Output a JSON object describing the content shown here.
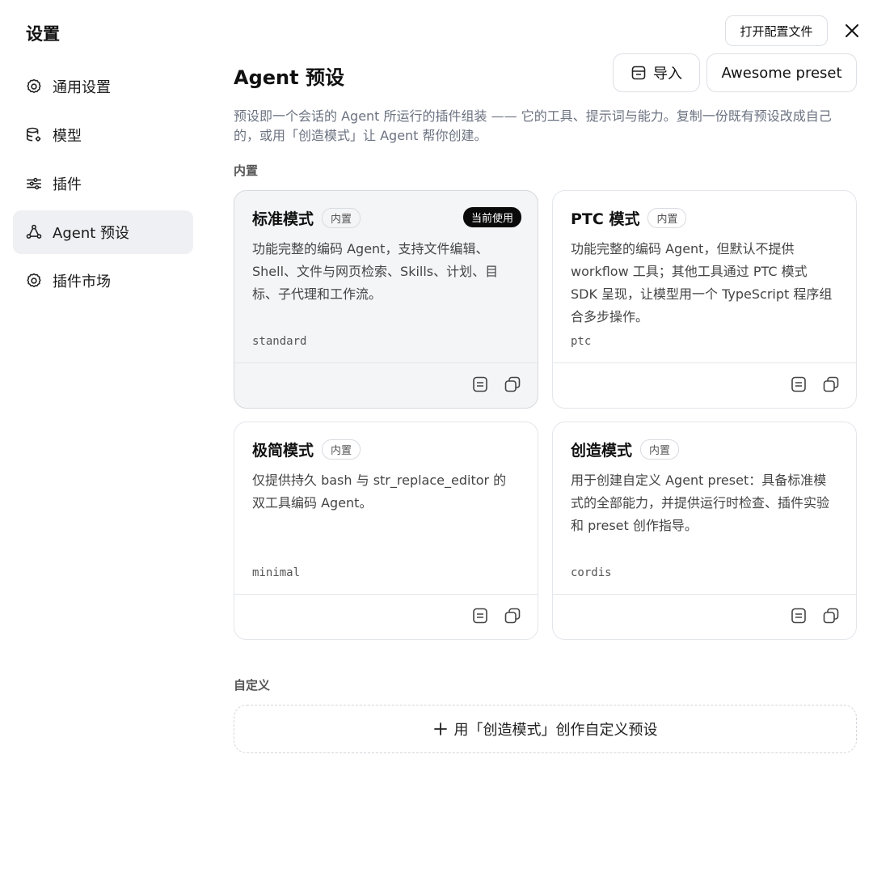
{
  "sidebar": {
    "title": "设置",
    "items": [
      {
        "label": "通用设置",
        "icon": "gear-icon"
      },
      {
        "label": "模型",
        "icon": "database-gear-icon"
      },
      {
        "label": "插件",
        "icon": "sliders-icon"
      },
      {
        "label": "Agent 预设",
        "icon": "agent-nodes-icon",
        "active": true
      },
      {
        "label": "插件市场",
        "icon": "gear-icon"
      }
    ]
  },
  "header": {
    "open_config": "打开配置文件",
    "close_icon": "close-icon"
  },
  "main": {
    "title": "Agent 预设",
    "import_label": "导入",
    "awesome_label": "Awesome preset",
    "description": "预设即一个会话的 Agent 所运行的插件组装 —— 它的工具、提示词与能力。复制一份既有预设改成自己的，或用「创造模式」让 Agent 帮你创建。",
    "builtin_label": "内置",
    "custom_label": "自定义",
    "create_label": "用「创造模式」创作自定义预设"
  },
  "presets": [
    {
      "title": "标准模式",
      "badge": "内置",
      "current": "当前使用",
      "desc": "功能完整的编码 Agent，支持文件编辑、Shell、文件与网页检索、Skills、计划、目标、子代理和工作流。",
      "id": "standard"
    },
    {
      "title": "PTC 模式",
      "badge": "内置",
      "desc": "功能完整的编码 Agent，但默认不提供 workflow 工具；其他工具通过 PTC 模式 SDK 呈现，让模型用一个 TypeScript 程序组合多步操作。",
      "id": "ptc"
    },
    {
      "title": "极简模式",
      "badge": "内置",
      "desc": "仅提供持久 bash 与 str_replace_editor 的双工具编码 Agent。",
      "id": "minimal"
    },
    {
      "title": "创造模式",
      "badge": "内置",
      "desc": "用于创建自定义 Agent preset：具备标准模式的全部能力，并提供运行时检查、插件实验和 preset 创作指导。",
      "id": "cordis"
    }
  ],
  "colors": {
    "active_bg": "#eef0f3",
    "current_badge": "#0a0a0a",
    "muted_text": "#6b7280"
  }
}
